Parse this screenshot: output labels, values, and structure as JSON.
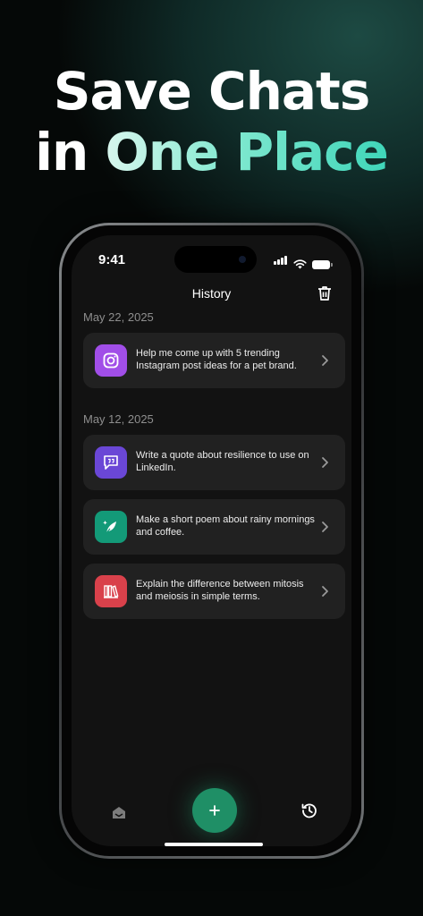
{
  "headline": {
    "line1": "Save Chats",
    "line2_plain": "in ",
    "line2_accent": "One Place"
  },
  "status_bar": {
    "time": "9:41"
  },
  "header": {
    "title": "History"
  },
  "groups": [
    {
      "date": "May 22, 2025",
      "items": [
        {
          "text": "Help me come up with 5 trending Instagram post ideas for a pet brand.",
          "icon": "instagram-icon",
          "color": "#a14ee8"
        }
      ]
    },
    {
      "date": "May 12, 2025",
      "items": [
        {
          "text": "Write a quote about resilience to use on LinkedIn.",
          "icon": "quote-icon",
          "color": "#6a47d6"
        },
        {
          "text": "Make a short poem about rainy mornings and coffee.",
          "icon": "feather-icon",
          "color": "#139a78"
        },
        {
          "text": "Explain the difference between mitosis and meiosis in simple terms.",
          "icon": "books-icon",
          "color": "#d9414b"
        }
      ]
    }
  ],
  "colors": {
    "fab": "#1f8f66",
    "accent_start": "#d8f7ee",
    "accent_end": "#3fd6b9"
  }
}
